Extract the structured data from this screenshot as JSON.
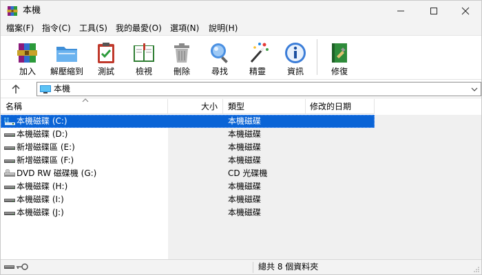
{
  "window": {
    "title": "本機"
  },
  "menu": [
    "檔案(F)",
    "指令(C)",
    "工具(S)",
    "我的最愛(O)",
    "選項(N)",
    "說明(H)"
  ],
  "toolbar": [
    {
      "label": "加入",
      "icon": "add-archive-icon"
    },
    {
      "label": "解壓縮到",
      "icon": "extract-folder-icon"
    },
    {
      "label": "測試",
      "icon": "test-clipboard-icon"
    },
    {
      "label": "檢視",
      "icon": "view-book-icon"
    },
    {
      "label": "刪除",
      "icon": "trash-can-icon"
    },
    {
      "label": "尋找",
      "icon": "magnifier-icon"
    },
    {
      "label": "精靈",
      "icon": "magic-wand-icon"
    },
    {
      "label": "資訊",
      "icon": "info-icon"
    },
    {
      "label": "修復",
      "icon": "repair-book-icon"
    }
  ],
  "address": {
    "path": "本機"
  },
  "columns": {
    "name": "名稱",
    "size": "大小",
    "type": "類型",
    "modified": "修改的日期"
  },
  "rows": [
    {
      "name": "本機磁碟 (C:)",
      "type": "本機磁碟",
      "icon": "system-drive-icon",
      "selected": true
    },
    {
      "name": "本機磁碟 (D:)",
      "type": "本機磁碟",
      "icon": "drive-icon"
    },
    {
      "name": "新增磁碟區 (E:)",
      "type": "本機磁碟",
      "icon": "drive-icon"
    },
    {
      "name": "新增磁碟區 (F:)",
      "type": "本機磁碟",
      "icon": "drive-icon"
    },
    {
      "name": "DVD RW 磁碟機 (G:)",
      "type": "CD 光碟機",
      "icon": "dvd-drive-icon"
    },
    {
      "name": "本機磁碟 (H:)",
      "type": "本機磁碟",
      "icon": "drive-icon"
    },
    {
      "name": "本機磁碟 (I:)",
      "type": "本機磁碟",
      "icon": "drive-icon"
    },
    {
      "name": "本機磁碟 (J:)",
      "type": "本機磁碟",
      "icon": "drive-icon"
    }
  ],
  "status": {
    "text": "總共 8 個資料夾"
  },
  "colors": {
    "selection": "#0a64d6",
    "chrome": "#f3f3f3"
  }
}
